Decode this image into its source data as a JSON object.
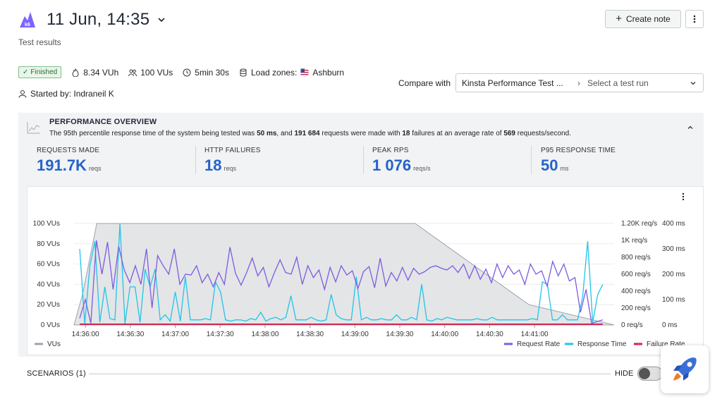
{
  "header": {
    "title": "11 Jun, 14:35",
    "subtitle": "Test results",
    "logo_text": "k6",
    "create_note_label": "Create note"
  },
  "meta": {
    "status": "Finished",
    "vuh": "8.34 VUh",
    "vus": "100 VUs",
    "duration": "5min 30s",
    "load_zones_label": "Load zones:",
    "load_zone": "Ashburn",
    "started_by": "Started by: Indraneil K"
  },
  "compare": {
    "label": "Compare with",
    "selected": "Kinsta Performance Test ...",
    "placeholder": "Select a test run"
  },
  "overview": {
    "title": "PERFORMANCE OVERVIEW",
    "desc_1": "The 95th percentile response time of the system being tested was ",
    "p95": "50 ms",
    "desc_2": ", and ",
    "requests": "191 684",
    "desc_3": " requests were made with ",
    "failures": "18",
    "desc_4": " failures at an average rate of ",
    "rate": "569",
    "desc_5": " requests/second."
  },
  "stats": [
    {
      "label": "REQUESTS MADE",
      "value": "191.7K",
      "unit": "reqs"
    },
    {
      "label": "HTTP FAILURES",
      "value": "18",
      "unit": "reqs"
    },
    {
      "label": "PEAK RPS",
      "value": "1 076",
      "unit": "reqs/s"
    },
    {
      "label": "P95 RESPONSE TIME",
      "value": "50",
      "unit": "ms"
    }
  ],
  "chart_data": {
    "type": "line",
    "x_ticks": [
      "14:36:00",
      "14:36:30",
      "14:37:00",
      "14:37:30",
      "14:38:00",
      "14:38:30",
      "14:39:00",
      "14:39:30",
      "14:40:00",
      "14:40:30",
      "14:41:00"
    ],
    "y_left_ticks": [
      "0 VUs",
      "20 VUs",
      "40 VUs",
      "60 VUs",
      "80 VUs",
      "100 VUs"
    ],
    "y_right1_ticks": [
      "0 req/s",
      "200 req/s",
      "400 req/s",
      "600 req/s",
      "800 req/s",
      "1K req/s",
      "1.20K req/s"
    ],
    "y_right2_ticks": [
      "0 ms",
      "100 ms",
      "200 ms",
      "300 ms",
      "400 ms"
    ],
    "ylim_vus": [
      0,
      100
    ],
    "ylim_req": [
      0,
      1200
    ],
    "ylim_ms": [
      0,
      400
    ],
    "legend": {
      "vus": "VUs",
      "request_rate": "Request Rate",
      "response_time": "Response Time",
      "failure_rate": "Failure Rate"
    },
    "colors": {
      "vus": "#9ca3af",
      "request_rate": "#7c5ce0",
      "response_time": "#22c4e8",
      "failure_rate": "#d0264e"
    },
    "vus_series": {
      "t": [
        0,
        0.3,
        0.8,
        1,
        2,
        12,
        16,
        19
      ],
      "values": [
        0,
        30,
        100,
        100,
        100,
        100,
        20,
        0
      ]
    },
    "request_rate": [
      80,
      300,
      20,
      1000,
      600,
      980,
      420,
      930,
      650,
      500,
      700,
      480,
      900,
      200,
      820,
      700,
      600,
      900,
      480,
      600,
      590,
      700,
      500,
      600,
      450,
      620,
      480,
      920,
      610,
      470,
      620,
      790,
      580,
      680,
      450,
      620,
      770,
      620,
      600,
      800,
      480,
      700,
      560,
      650,
      420,
      680,
      510,
      700,
      590,
      640,
      430,
      630,
      690,
      440,
      790,
      460,
      620,
      520,
      680,
      530,
      670,
      600,
      630,
      680,
      700,
      670,
      650,
      700,
      620,
      720,
      550,
      700,
      540,
      660,
      500,
      720,
      560,
      700,
      600,
      650,
      480,
      720,
      600,
      640,
      460,
      750,
      580,
      720,
      520,
      560,
      150,
      420,
      20,
      40,
      60
    ],
    "response_time": [
      300,
      5,
      230,
      330,
      10,
      150,
      25,
      20,
      400,
      5,
      150,
      150,
      10,
      220,
      150,
      220,
      20,
      40,
      15,
      130,
      15,
      190,
      20,
      20,
      20,
      25,
      20,
      170,
      130,
      20,
      15,
      20,
      20,
      15,
      25,
      20,
      50,
      15,
      25,
      30,
      20,
      30,
      115,
      20,
      20,
      20,
      30,
      20,
      15,
      20,
      120,
      40,
      25,
      20,
      20,
      190,
      20,
      30,
      20,
      20,
      25,
      20,
      20,
      40,
      20,
      20,
      30,
      20,
      160,
      20,
      15,
      25,
      20,
      30,
      25,
      20,
      20,
      20,
      20,
      25,
      20,
      20,
      30,
      20,
      20,
      20,
      20,
      20,
      20,
      20,
      25,
      20,
      170,
      160,
      20,
      20,
      40,
      20,
      20,
      20,
      110,
      330,
      10,
      120,
      160
    ],
    "failure_rate": "0"
  },
  "scenarios": {
    "label": "SCENARIOS (1)",
    "hide_label": "HIDE"
  }
}
